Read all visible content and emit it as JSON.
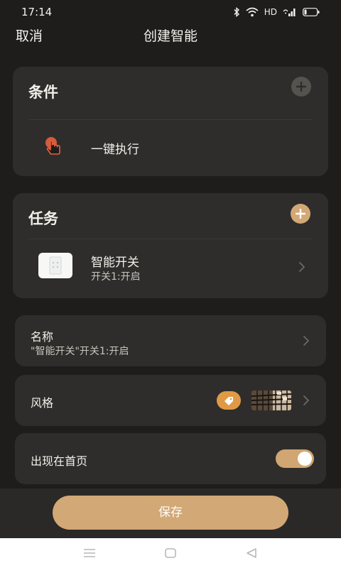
{
  "status_bar": {
    "time": "17:14",
    "network_label": "HD",
    "icons": [
      "bluetooth-icon",
      "wifi-icon",
      "signal-icon",
      "battery-icon"
    ]
  },
  "header": {
    "cancel_label": "取消",
    "title": "创建智能"
  },
  "condition": {
    "title": "条件",
    "items": [
      {
        "label": "一键执行",
        "icon": "tap-hand-icon"
      }
    ]
  },
  "task": {
    "title": "任务",
    "items": [
      {
        "name": "智能开关",
        "detail": "开关1:开启",
        "icon": "switch-device-icon"
      }
    ]
  },
  "name_setting": {
    "label": "名称",
    "value": "\"智能开关\"开关1:开启"
  },
  "style_setting": {
    "label": "风格",
    "icon": "tag-icon"
  },
  "show_on_home": {
    "label": "出现在首页",
    "enabled": true
  },
  "save_label": "保存",
  "colors": {
    "background": "#1e1d1c",
    "card": "#2e2d2b",
    "accent": "#d2a876",
    "tag": "#e09a45",
    "tap_icon": "#e8603f"
  },
  "nav": {
    "icons": [
      "menu-icon",
      "home-icon",
      "back-icon"
    ]
  }
}
